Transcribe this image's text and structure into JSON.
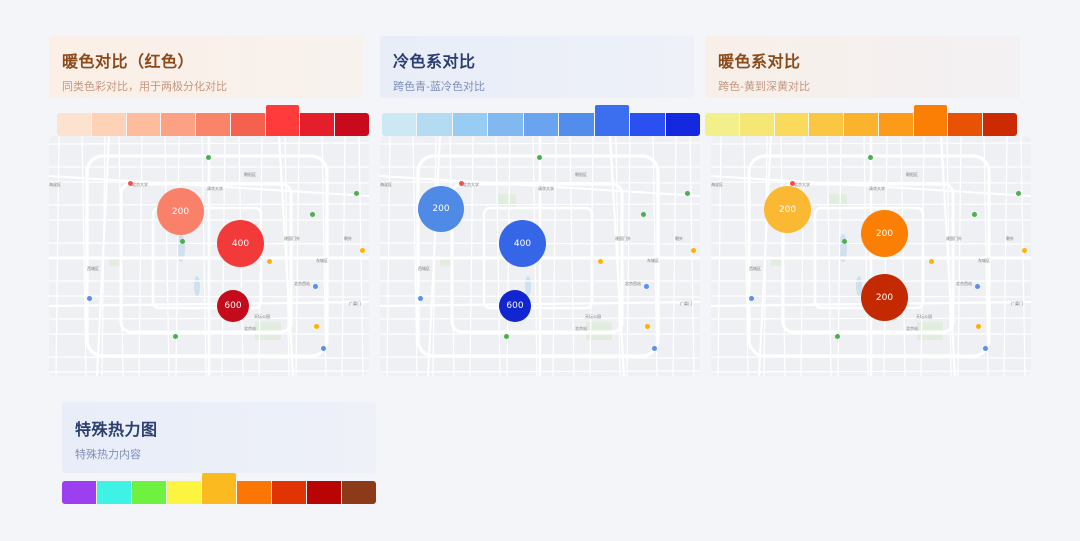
{
  "panels": [
    {
      "title": "暖色对比（红色）",
      "subtitle": "同类色彩对比，用于两极分化对比",
      "title_color": "#8a4a1a",
      "subtitle_color": "#c39880",
      "header_bg": [
        "#fbefe6",
        "#f7f2ee"
      ],
      "swatches": [
        "#fde3cf",
        "#fdd2b7",
        "#fcbc9d",
        "#fca183",
        "#f98469",
        "#f4624f",
        "#ff3b3b",
        "#e51e2c",
        "#c90a1c"
      ],
      "highlight": 6,
      "bubbles": [
        {
          "label": "200",
          "color": "#fa8169"
        },
        {
          "label": "400",
          "color": "#f23a3a"
        },
        {
          "label": "600",
          "color": "#c40b1c"
        }
      ]
    },
    {
      "title": "冷色系对比",
      "subtitle": "跨色青-蓝冷色对比",
      "title_color": "#2a3e70",
      "subtitle_color": "#7f8fb8",
      "header_bg": [
        "#e8edf8",
        "#eef1f8"
      ],
      "swatches": [
        "#cce8f2",
        "#b3dcf2",
        "#99ccf2",
        "#82b8f0",
        "#6aa3ef",
        "#528dec",
        "#3c6ff0",
        "#2a50f2",
        "#1428e0"
      ],
      "highlight": 6,
      "bubbles": [
        {
          "label": "200",
          "color": "#4f8ae6"
        },
        {
          "label": "400",
          "color": "#3566e8"
        },
        {
          "label": "600",
          "color": "#1226d0"
        }
      ]
    },
    {
      "title": "暖色系对比",
      "subtitle": "跨色-黄到深黄对比",
      "title_color": "#8a4a1a",
      "subtitle_color": "#c39880",
      "header_bg": [
        "#f8efe8",
        "#f3f1f4"
      ],
      "swatches": [
        "#f2f08a",
        "#f4e774",
        "#f9da5a",
        "#fbc743",
        "#fbb32e",
        "#fb9b19",
        "#fb7f05",
        "#e85204",
        "#cc2a02"
      ],
      "highlight": 6,
      "bubbles": [
        {
          "label": "200",
          "color": "#fbb833"
        },
        {
          "label": "200",
          "color": "#fb7f05"
        },
        {
          "label": "200",
          "color": "#c42a02"
        }
      ]
    }
  ],
  "special": {
    "title": "特殊热力图",
    "subtitle": "特殊热力内容",
    "title_color": "#2a3e70",
    "subtitle_color": "#7f8fb8",
    "swatches": [
      "#9b3ff0",
      "#3ff2e6",
      "#6ef23f",
      "#fcf53f",
      "#fbba1f",
      "#fb7605",
      "#e03405",
      "#b80404",
      "#8c3a1a"
    ],
    "highlight": 4
  },
  "map_labels": [
    "海淀区",
    "朝阳区",
    "西城区",
    "东城区",
    "北京西站",
    "北京站",
    "北京大学",
    "清华大学",
    "广渠门",
    "天坛公园",
    "建国门外",
    "朝外"
  ]
}
